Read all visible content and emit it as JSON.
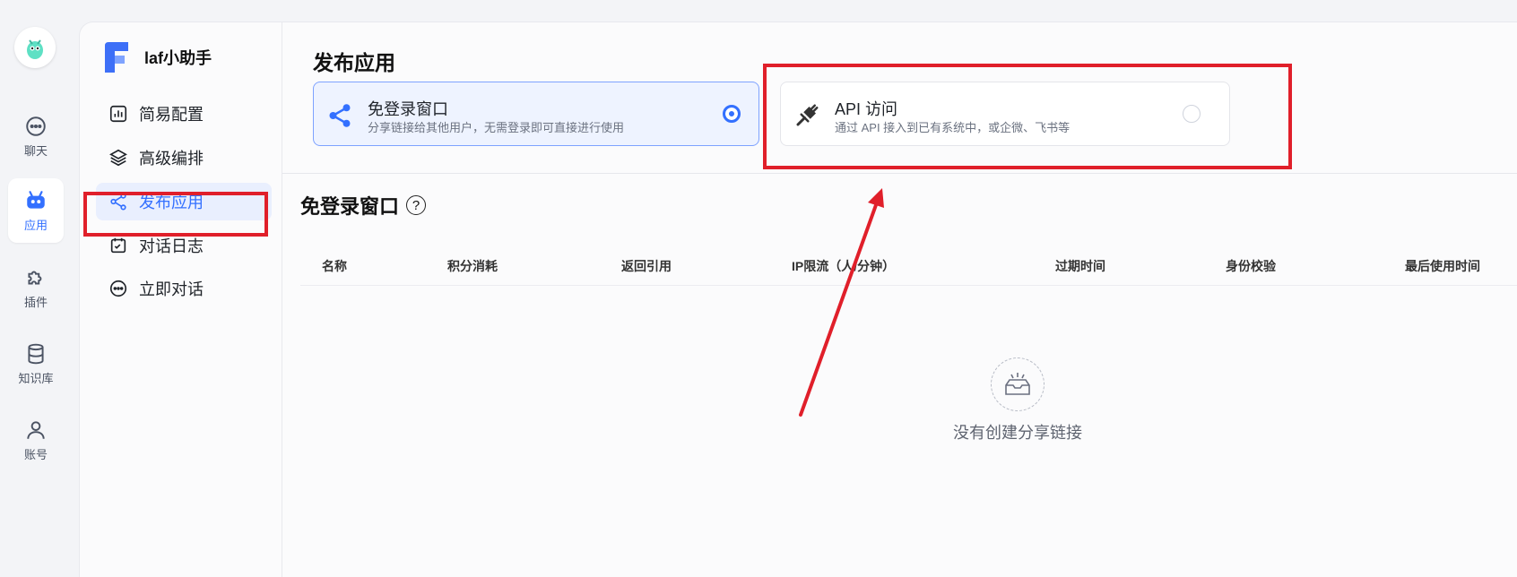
{
  "rail": {
    "items": [
      {
        "label": "聊天",
        "icon": "chat-bubble-icon"
      },
      {
        "label": "应用",
        "icon": "robot-icon",
        "active": true
      },
      {
        "label": "插件",
        "icon": "puzzle-icon"
      },
      {
        "label": "知识库",
        "icon": "database-icon"
      },
      {
        "label": "账号",
        "icon": "user-icon"
      }
    ]
  },
  "app": {
    "name": "laf小助手",
    "menu": [
      {
        "label": "简易配置",
        "icon": "bar-chart-icon"
      },
      {
        "label": "高级编排",
        "icon": "layers-icon"
      },
      {
        "label": "发布应用",
        "icon": "share-icon",
        "active": true
      },
      {
        "label": "对话日志",
        "icon": "log-icon"
      },
      {
        "label": "立即对话",
        "icon": "chat-dots-icon"
      }
    ]
  },
  "main": {
    "title": "发布应用",
    "options": [
      {
        "title": "免登录窗口",
        "desc": "分享链接给其他用户，无需登录即可直接进行使用",
        "selected": true,
        "icon": "share-nodes-icon"
      },
      {
        "title": "API 访问",
        "desc": "通过 API 接入到已有系统中，或企微、飞书等",
        "selected": false,
        "icon": "plug-icon"
      }
    ],
    "section_title": "免登录窗口",
    "help_symbol": "?",
    "columns": [
      "名称",
      "积分消耗",
      "返回引用",
      "IP限流（人/分钟）",
      "过期时间",
      "身份校验",
      "最后使用时间"
    ],
    "empty_text": "没有创建分享链接"
  },
  "colors": {
    "accent": "#3370ff",
    "annotation_red": "#e01f2a"
  }
}
